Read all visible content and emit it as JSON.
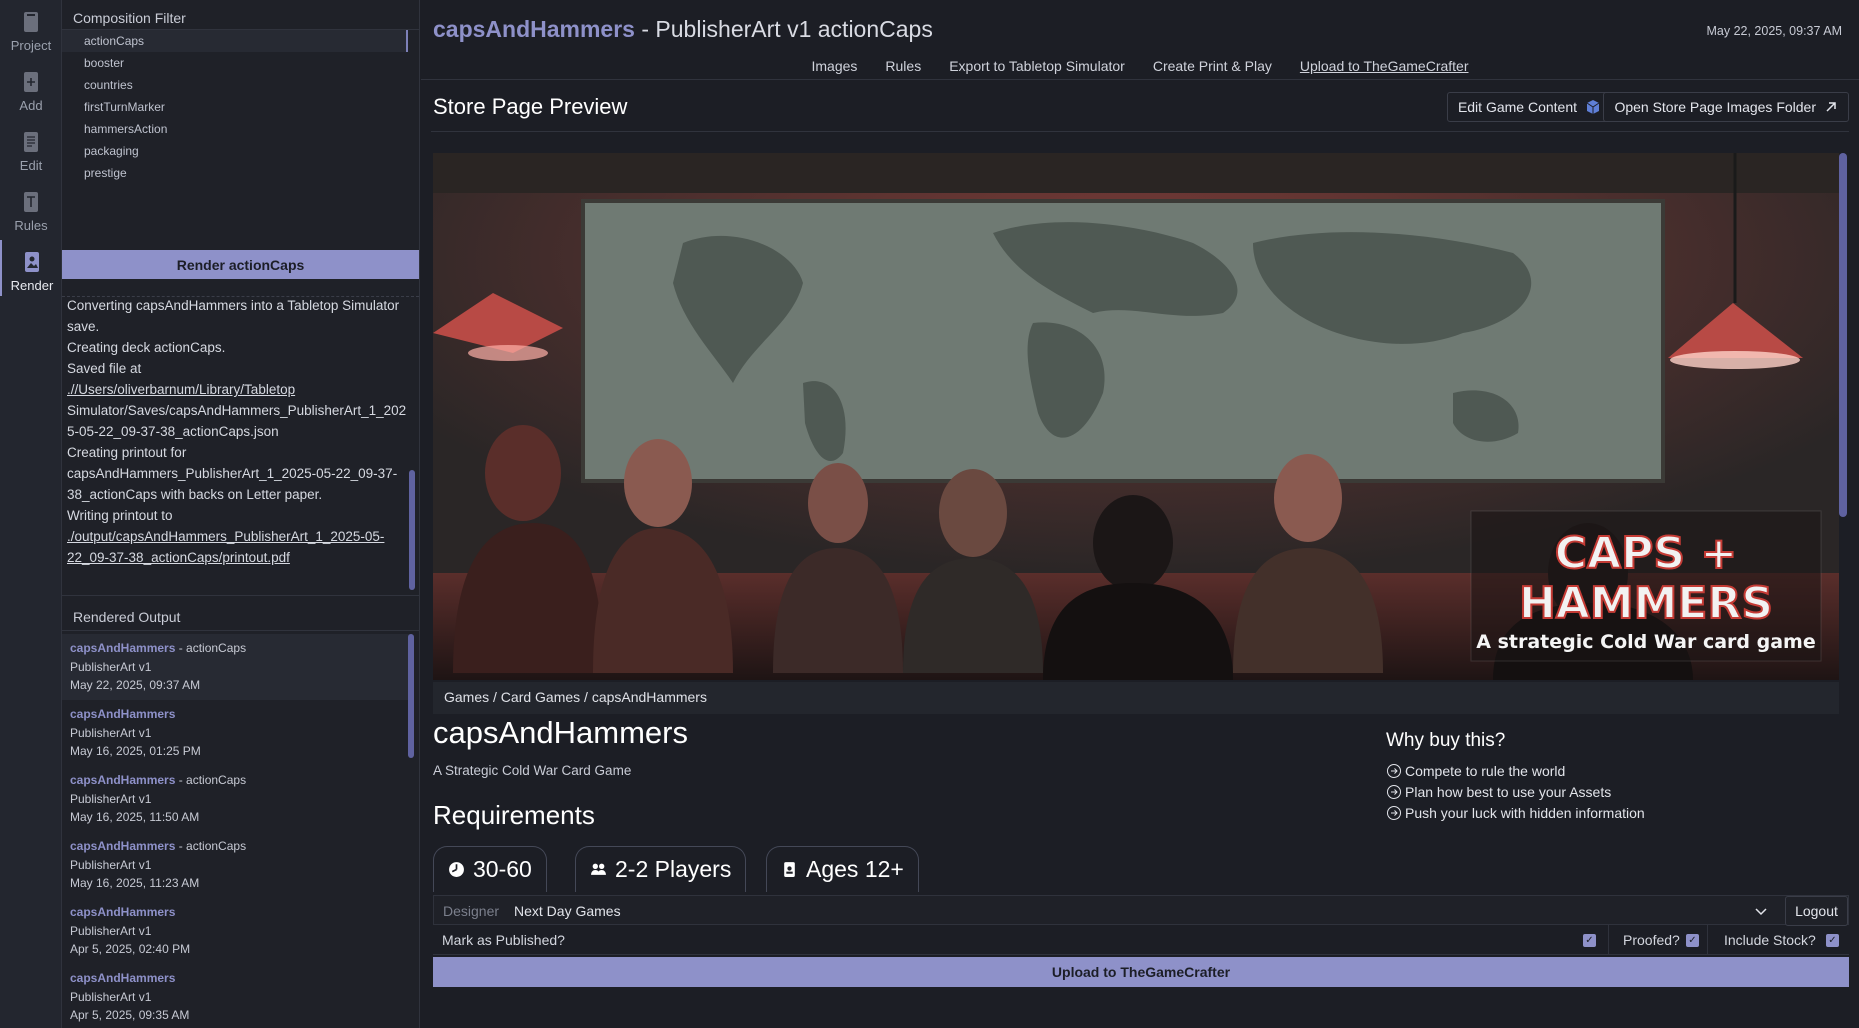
{
  "rail": [
    {
      "label": "Project",
      "icon": "project-icon"
    },
    {
      "label": "Add",
      "icon": "add-icon"
    },
    {
      "label": "Edit",
      "icon": "edit-icon"
    },
    {
      "label": "Rules",
      "icon": "rules-icon"
    },
    {
      "label": "Render",
      "icon": "render-icon"
    }
  ],
  "composition": {
    "title": "Composition Filter",
    "items": [
      "actionCaps",
      "booster",
      "countries",
      "firstTurnMarker",
      "hammersAction",
      "packaging",
      "prestige"
    ],
    "selected": "actionCaps",
    "render_button": "Render actionCaps"
  },
  "log": {
    "line1": "Converting capsAndHammers into a Tabletop Simulator save.",
    "line2": "Creating deck actionCaps.",
    "line3": "Saved file at",
    "line4_link": ".//Users/oliverbarnum/Library/Tabletop",
    "line5": "Simulator/Saves/capsAndHammers_PublisherArt_1_2025-05-22_09-37-38_actionCaps.json",
    "line6": "Creating printout for capsAndHammers_PublisherArt_1_2025-05-22_09-37-38_actionCaps with backs on Letter paper.",
    "line7": "Writing printout to",
    "line8_link": "./output/capsAndHammers_PublisherArt_1_2025-05-22_09-37-38_actionCaps/printout.pdf"
  },
  "rendered_output": {
    "title": "Rendered Output",
    "items": [
      {
        "name": "capsAndHammers",
        "suffix": " - actionCaps",
        "version": "PublisherArt v1",
        "date": "May 22, 2025, 09:37 AM"
      },
      {
        "name": "capsAndHammers",
        "suffix": "",
        "version": "PublisherArt v1",
        "date": "May 16, 2025, 01:25 PM"
      },
      {
        "name": "capsAndHammers",
        "suffix": " - actionCaps",
        "version": "PublisherArt v1",
        "date": "May 16, 2025, 11:50 AM"
      },
      {
        "name": "capsAndHammers",
        "suffix": " - actionCaps",
        "version": "PublisherArt v1",
        "date": "May 16, 2025, 11:23 AM"
      },
      {
        "name": "capsAndHammers",
        "suffix": "",
        "version": "PublisherArt v1",
        "date": "Apr 5, 2025, 02:40 PM"
      },
      {
        "name": "capsAndHammers",
        "suffix": "",
        "version": "PublisherArt v1",
        "date": "Apr 5, 2025, 09:35 AM"
      }
    ]
  },
  "header": {
    "project": "capsAndHammers",
    "rest": " - PublisherArt v1 actionCaps",
    "timestamp": "May 22, 2025, 09:37 AM"
  },
  "nav": [
    "Images",
    "Rules",
    "Export to Tabletop Simulator",
    "Create Print & Play",
    "Upload to TheGameCrafter"
  ],
  "nav_active": "Upload to TheGameCrafter",
  "store": {
    "title": "Store Page Preview",
    "edit_button": "Edit Game Content",
    "open_button": "Open Store Page Images Folder",
    "hero_logo_line1": "CAPS +",
    "hero_logo_line2": "HAMMERS",
    "hero_tagline": "A strategic Cold War card game",
    "breadcrumb": "Games / Card Games / capsAndHammers",
    "game_name": "capsAndHammers",
    "game_subtitle": "A Strategic Cold War Card Game",
    "requirements_title": "Requirements",
    "pills": [
      "30-60",
      "2-2 Players",
      "Ages 12+"
    ],
    "why_title": "Why buy this?",
    "why_items": [
      "Compete to rule the world",
      "Plan how best to use your Assets",
      "Push your luck with hidden information"
    ]
  },
  "form": {
    "designer_label": "Designer",
    "designer_value": "Next Day Games",
    "logout": "Logout",
    "published_label": "Mark as Published?",
    "proofed_label": "Proofed?",
    "stock_label": "Include Stock?",
    "upload_button": "Upload to TheGameCrafter"
  },
  "colors": {
    "accent": "#8e91c9",
    "background": "#1c1e25",
    "panel": "#1f2128"
  }
}
